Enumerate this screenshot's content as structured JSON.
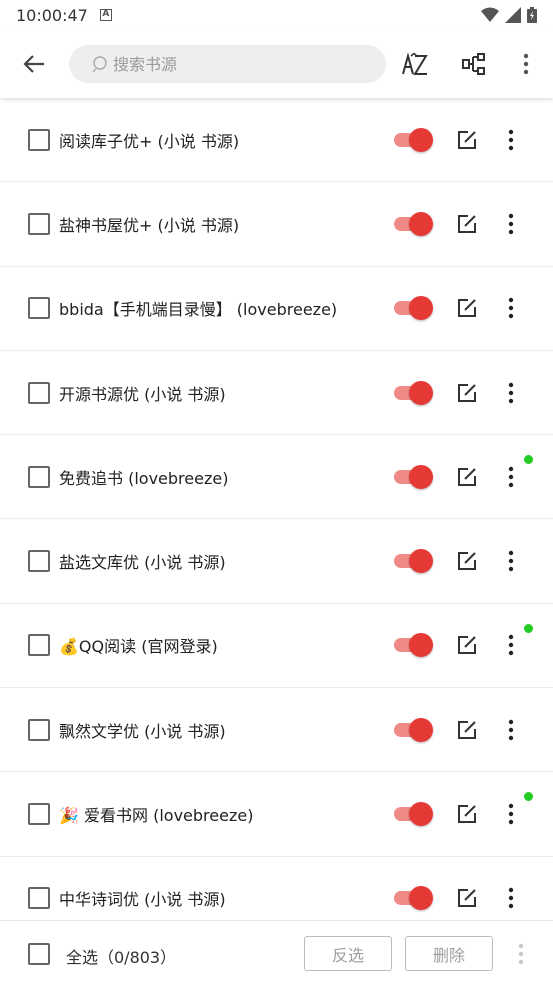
{
  "status_bar": {
    "time": "10:00:47",
    "notification_letter": "A"
  },
  "toolbar": {
    "search_placeholder": "搜索书源"
  },
  "sources": [
    {
      "label": "阅读库子优+ (小说 书源)",
      "enabled": true,
      "has_update_dot": false
    },
    {
      "label": "盐神书屋优+ (小说 书源)",
      "enabled": true,
      "has_update_dot": false
    },
    {
      "label": "bbida【手机端目录慢】 (lovebreeze)",
      "enabled": true,
      "has_update_dot": false
    },
    {
      "label": "开源书源优 (小说 书源)",
      "enabled": true,
      "has_update_dot": false
    },
    {
      "label": "免费追书 (lovebreeze)",
      "enabled": true,
      "has_update_dot": true
    },
    {
      "label": "盐选文库优 (小说 书源)",
      "enabled": true,
      "has_update_dot": false
    },
    {
      "label": "💰QQ阅读 (官网登录)",
      "enabled": true,
      "has_update_dot": true
    },
    {
      "label": "飘然文学优 (小说 书源)",
      "enabled": true,
      "has_update_dot": false
    },
    {
      "label": "🎉 爱看书网 (lovebreeze)",
      "enabled": true,
      "has_update_dot": true
    },
    {
      "label": "中华诗词优 (小说 书源)",
      "enabled": true,
      "has_update_dot": false
    }
  ],
  "bottom_bar": {
    "select_all_label": "全选（0/803）",
    "invert_label": "反选",
    "delete_label": "删除"
  },
  "colors": {
    "switch_thumb": "#e53935",
    "switch_track": "#f08a86",
    "update_dot": "#22cc22"
  }
}
